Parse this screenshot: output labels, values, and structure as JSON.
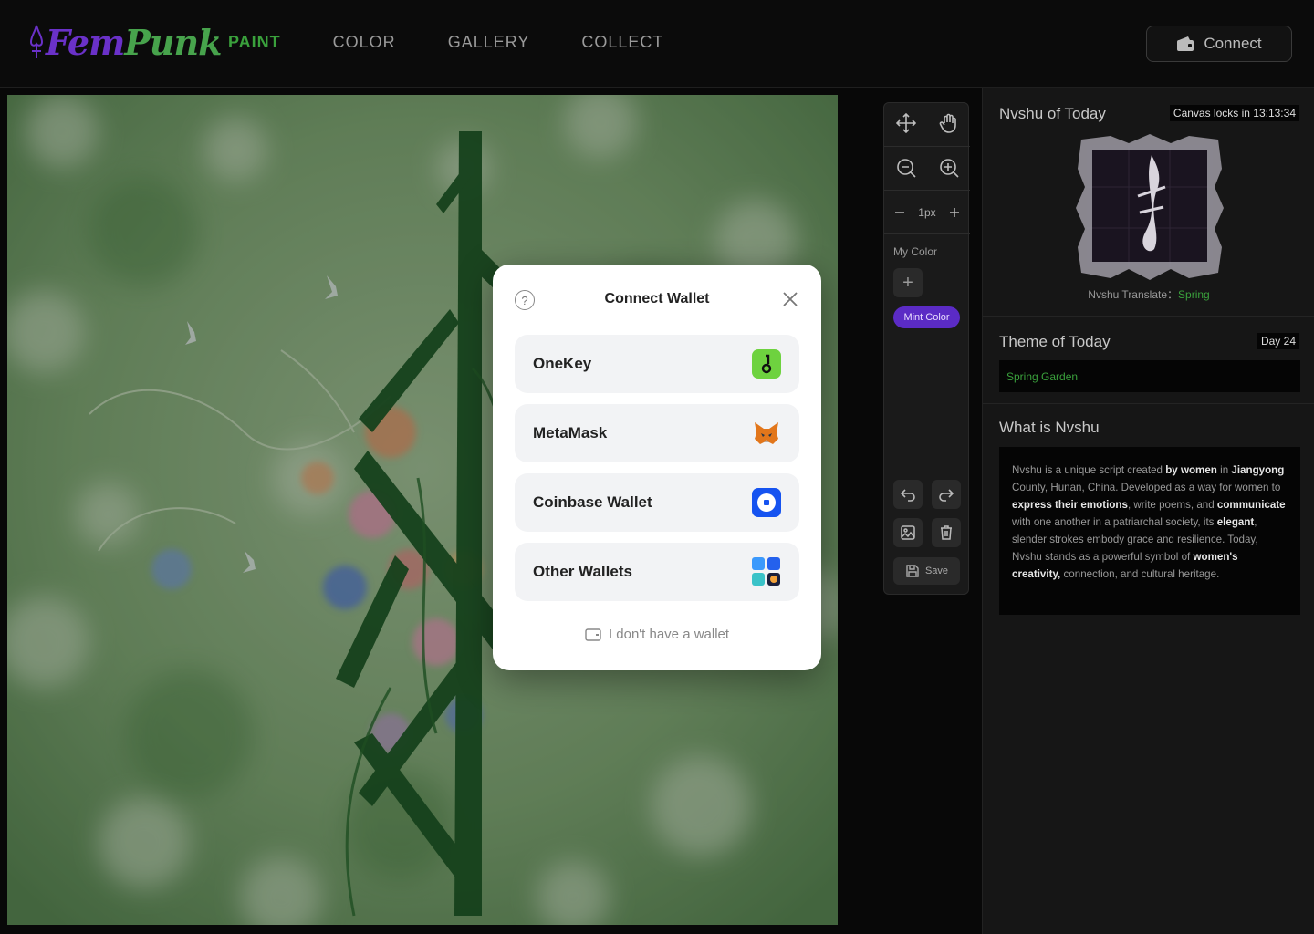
{
  "brand": {
    "logo_part1": "Fem",
    "logo_part2": "Punk"
  },
  "nav": {
    "items": [
      "PAINT",
      "COLOR",
      "GALLERY",
      "COLLECT"
    ],
    "active": "PAINT"
  },
  "header": {
    "connect_label": "Connect"
  },
  "toolbar": {
    "brush_size": "1px",
    "my_color_label": "My Color",
    "add_color": "+",
    "mint_label": "Mint Color",
    "save_label": "Save"
  },
  "sidebar": {
    "nvshu_title": "Nvshu of Today",
    "lock_text": "Canvas locks in 13:13:34",
    "translate_label": "Nvshu Translate：",
    "translate_value": "Spring",
    "theme_title": "Theme of Today",
    "day_tag": "Day 24",
    "theme_value": "Spring Garden",
    "about_title": "What is Nvshu",
    "about": [
      {
        "t": "Nvshu is a unique script created ",
        "b": false
      },
      {
        "t": "by women",
        "b": true
      },
      {
        "t": " in ",
        "b": false
      },
      {
        "t": "Jiangyong",
        "b": true
      },
      {
        "t": " County, Hunan, China. Developed as a way for women to ",
        "b": false
      },
      {
        "t": "express their emotions",
        "b": true
      },
      {
        "t": ", write poems, and ",
        "b": false
      },
      {
        "t": "communicate",
        "b": true
      },
      {
        "t": " with one another in a patriarchal society, its ",
        "b": false
      },
      {
        "t": "elegant",
        "b": true
      },
      {
        "t": ", slender strokes embody grace and resilience. Today, Nvshu stands as a powerful symbol of ",
        "b": false
      },
      {
        "t": "women's creativity,",
        "b": true
      },
      {
        "t": " connection, and cultural heritage.",
        "b": false
      }
    ]
  },
  "modal": {
    "title": "Connect Wallet",
    "help": "?",
    "wallets": [
      "OneKey",
      "MetaMask",
      "Coinbase Wallet",
      "Other Wallets"
    ],
    "no_wallet": "I don't have a wallet"
  },
  "colors": {
    "accent_green": "#3aa13c",
    "accent_purple": "#5b2bc5",
    "onekey": "#6ed23f",
    "coinbase": "#1653f0"
  }
}
